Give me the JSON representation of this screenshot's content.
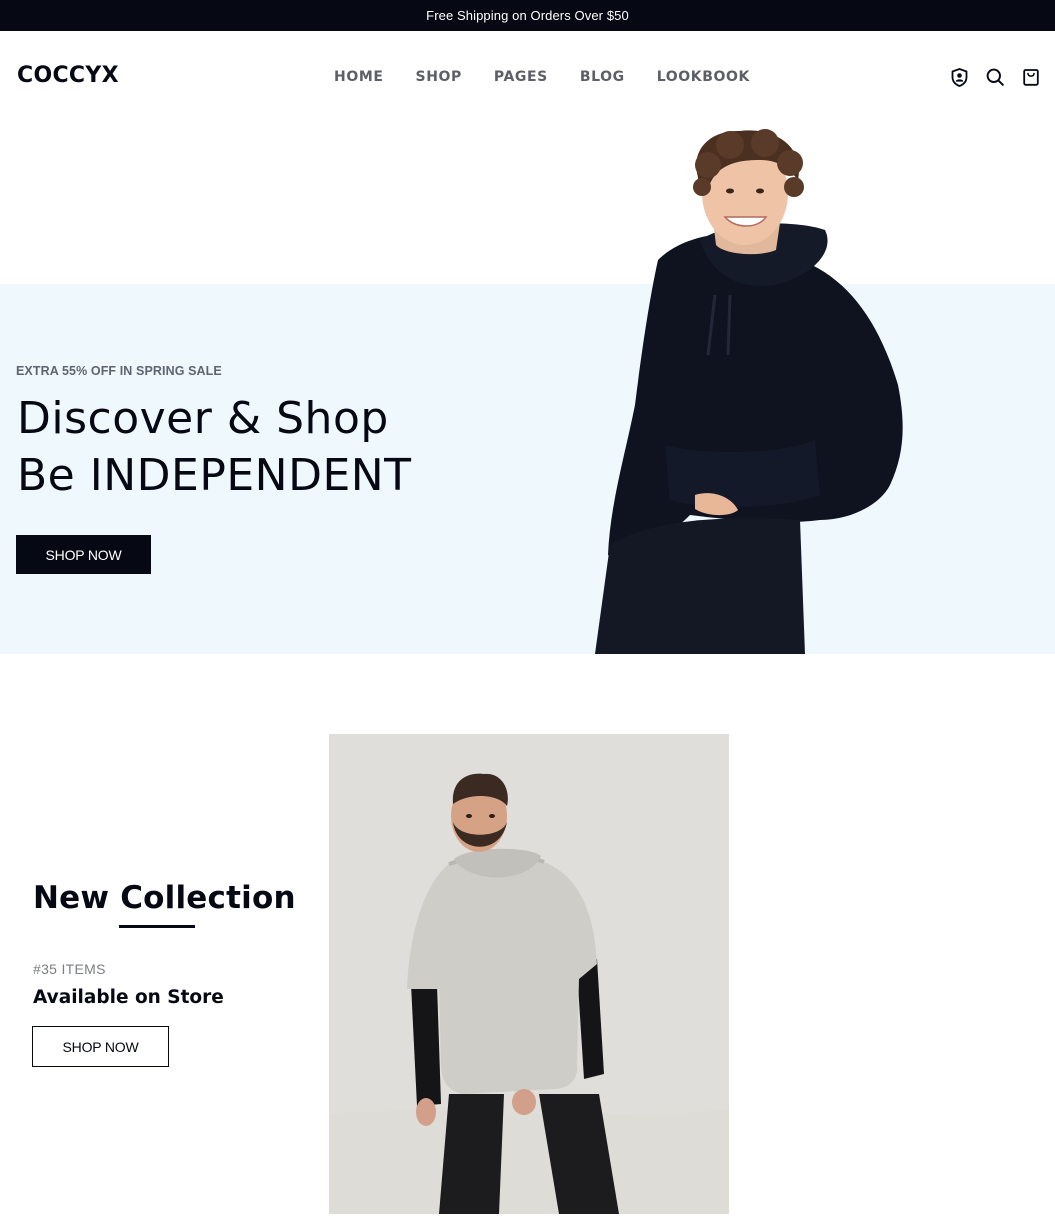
{
  "announcement": "Free Shipping on Orders Over $50",
  "header": {
    "logo": "COCCYX",
    "nav": [
      "HOME",
      "SHOP",
      "PAGES",
      "BLOG",
      "LOOKBOOK"
    ],
    "icons": [
      "user-shield-icon",
      "search-icon",
      "shopping-bag-icon"
    ]
  },
  "hero": {
    "eyebrow": "EXTRA 55% OFF IN SPRING SALE",
    "title_line1": "Discover & Shop",
    "title_line2": "Be INDEPENDENT",
    "button": "SHOP NOW",
    "background": "#eff8fd"
  },
  "collection": {
    "title": "New Collection",
    "count": "#35 ITEMS",
    "subtitle": "Available on Store",
    "button": "SHOP NOW"
  },
  "colors": {
    "dark": "#060914",
    "nav_text": "#5c5f66",
    "hero_bg": "#eff8fd"
  }
}
